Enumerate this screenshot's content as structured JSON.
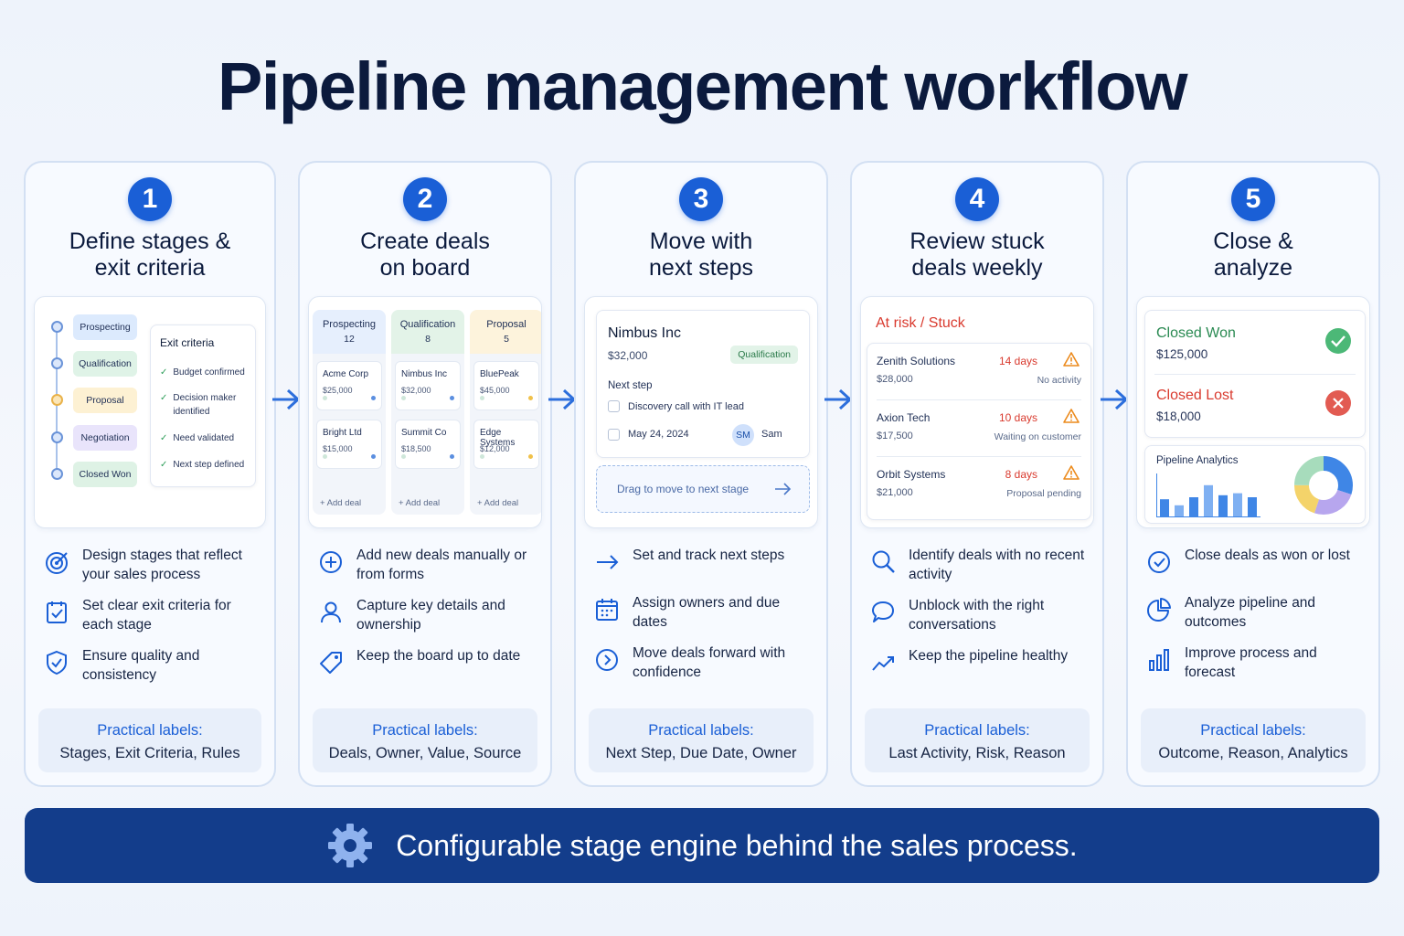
{
  "title": "Pipeline management workflow",
  "colors": {
    "accent": "#1a5fd6",
    "banner": "#133d8b",
    "danger": "#d93a2e",
    "success": "#2f9e5a"
  },
  "steps": [
    {
      "number": "1",
      "title_line1": "Define stages &",
      "title_line2": "exit criteria",
      "mock": {
        "stages": [
          "Prospecting",
          "Qualification",
          "Proposal",
          "Negotiation",
          "Closed Won"
        ],
        "exit_title": "Exit criteria",
        "exit_items": [
          "Budget confirmed",
          "Decision maker identified",
          "Need validated",
          "Next step defined"
        ]
      },
      "bullets": [
        {
          "icon": "target-icon",
          "text": "Design stages that reflect your sales process"
        },
        {
          "icon": "checklist-icon",
          "text": "Set clear exit criteria for each stage"
        },
        {
          "icon": "shield-icon",
          "text": "Ensure quality and consistency"
        }
      ],
      "labels_heading": "Practical labels:",
      "labels_value": "Stages, Exit Criteria, Rules"
    },
    {
      "number": "2",
      "title_line1": "Create deals",
      "title_line2": "on board",
      "mock": {
        "columns": [
          {
            "name": "Prospecting",
            "count": "12",
            "deals": [
              {
                "name": "Acme Corp",
                "value": "$25,000"
              },
              {
                "name": "Bright Ltd",
                "value": "$15,000"
              }
            ]
          },
          {
            "name": "Qualification",
            "count": "8",
            "deals": [
              {
                "name": "Nimbus Inc",
                "value": "$32,000"
              },
              {
                "name": "Summit Co",
                "value": "$18,500"
              }
            ]
          },
          {
            "name": "Proposal",
            "count": "5",
            "deals": [
              {
                "name": "BluePeak",
                "value": "$45,000"
              },
              {
                "name": "Edge Systems",
                "value": "$12,000"
              }
            ]
          }
        ],
        "add_label": "+ Add deal"
      },
      "bullets": [
        {
          "icon": "plus-circle-icon",
          "text": "Add new deals manually or from forms"
        },
        {
          "icon": "user-icon",
          "text": "Capture key details and ownership"
        },
        {
          "icon": "tag-icon",
          "text": "Keep the board up to date"
        }
      ],
      "labels_heading": "Practical labels:",
      "labels_value": "Deals, Owner, Value, Source"
    },
    {
      "number": "3",
      "title_line1": "Move with",
      "title_line2": "next steps",
      "mock": {
        "deal_name": "Nimbus Inc",
        "deal_value": "$32,000",
        "stage_badge": "Qualification",
        "next_step_label": "Next step",
        "task": "Discovery call with IT lead",
        "due_date": "May 24, 2024",
        "owner_initials": "SM",
        "owner_name": "Sam",
        "drag_text": "Drag to move to next stage"
      },
      "bullets": [
        {
          "icon": "arrow-right-icon",
          "text": "Set and track next steps"
        },
        {
          "icon": "calendar-icon",
          "text": "Assign owners and due dates"
        },
        {
          "icon": "chevron-circle-icon",
          "text": "Move deals forward with confidence"
        }
      ],
      "labels_heading": "Practical labels:",
      "labels_value": "Next Step, Due Date, Owner"
    },
    {
      "number": "4",
      "title_line1": "Review stuck",
      "title_line2": "deals weekly",
      "mock": {
        "heading": "At risk / Stuck",
        "rows": [
          {
            "name": "Zenith Solutions",
            "value": "$28,000",
            "days": "14 days",
            "reason": "No activity"
          },
          {
            "name": "Axion Tech",
            "value": "$17,500",
            "days": "10 days",
            "reason": "Waiting on customer"
          },
          {
            "name": "Orbit Systems",
            "value": "$21,000",
            "days": "8 days",
            "reason": "Proposal pending"
          }
        ]
      },
      "bullets": [
        {
          "icon": "search-icon",
          "text": "Identify deals with no recent activity"
        },
        {
          "icon": "chat-icon",
          "text": "Unblock with the right conversations"
        },
        {
          "icon": "trend-up-icon",
          "text": "Keep the pipeline healthy"
        }
      ],
      "labels_heading": "Practical labels:",
      "labels_value": "Last Activity, Risk, Reason"
    },
    {
      "number": "5",
      "title_line1": "Close &",
      "title_line2": "analyze",
      "mock": {
        "won_label": "Closed Won",
        "won_value": "$125,000",
        "lost_label": "Closed Lost",
        "lost_value": "$18,000",
        "analytics_title": "Pipeline Analytics",
        "bars": [
          0.45,
          0.3,
          0.5,
          0.8,
          0.55,
          0.6,
          0.5
        ],
        "donut": [
          0.3,
          0.25,
          0.2,
          0.25
        ]
      },
      "bullets": [
        {
          "icon": "check-circle-icon",
          "text": "Close deals as won or lost"
        },
        {
          "icon": "pie-chart-icon",
          "text": "Analyze pipeline and outcomes"
        },
        {
          "icon": "bar-chart-icon",
          "text": "Improve process and forecast"
        }
      ],
      "labels_heading": "Practical labels:",
      "labels_value": "Outcome, Reason, Analytics"
    }
  ],
  "banner": {
    "icon": "gear-icon",
    "text": "Configurable stage engine behind the sales process."
  }
}
